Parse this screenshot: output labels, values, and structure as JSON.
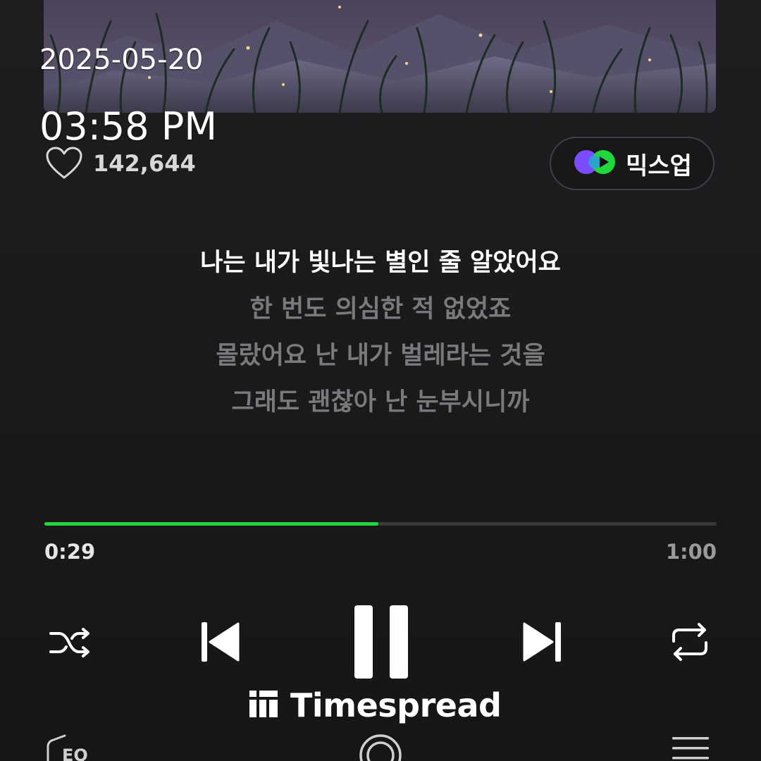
{
  "overlay": {
    "date": "2025-05-20",
    "time": "03:58 PM"
  },
  "like": {
    "icon": "heart-outline-icon",
    "count": "142,644"
  },
  "mixup": {
    "icon": "mixup-logo-icon",
    "label": "믹스업"
  },
  "lyrics": {
    "lines": [
      "나는 내가 빛나는 별인 줄 알았어요",
      "한 번도 의심한 적 없었죠",
      "몰랐어요 난 내가 벌레라는 것을",
      "그래도 괜찮아 난 눈부시니까"
    ],
    "current_index": 0
  },
  "playback": {
    "elapsed": "0:29",
    "total": "1:00",
    "progress_fraction": 0.497
  },
  "controls": {
    "shuffle_icon": "shuffle-icon",
    "prev_icon": "skip-previous-icon",
    "play_pause_icon": "pause-icon",
    "next_icon": "skip-next-icon",
    "repeat_icon": "repeat-icon"
  },
  "bottom_bar": {
    "eq_label": "EQ",
    "eq_icon": "equalizer-icon",
    "center_icon": "lens-icon",
    "menu_icon": "playlist-menu-icon"
  },
  "watermark": {
    "text": "Timespread",
    "icon": "timespread-logo-icon"
  },
  "colors": {
    "accent": "#21d63f",
    "background": "#1a1a1c",
    "lyric_dim": "#7a7a7d",
    "mixup_purple": "#7b4dff",
    "mixup_green": "#21d63f"
  }
}
